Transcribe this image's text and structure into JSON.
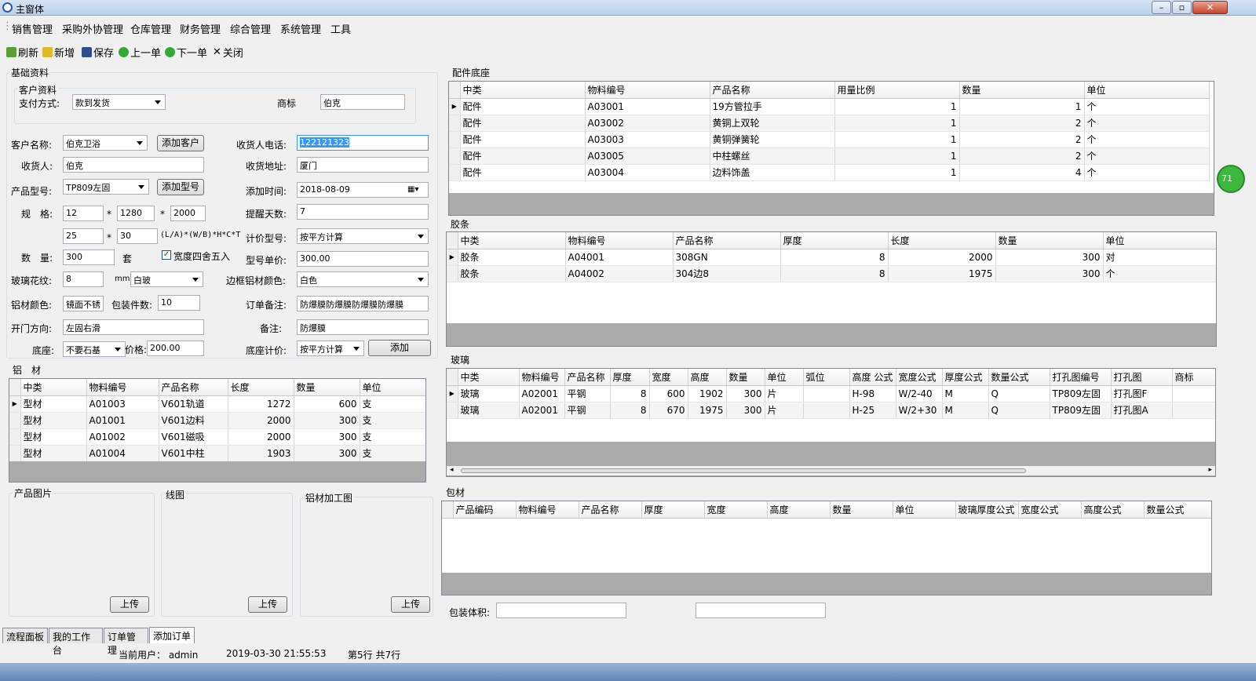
{
  "window": {
    "title": "主窗体"
  },
  "menu": [
    "销售管理",
    "采购外协管理",
    "仓库管理",
    "财务管理",
    "综合管理",
    "系统管理",
    "工具"
  ],
  "toolbar": {
    "refresh": "刷新",
    "new": "新增",
    "save": "保存",
    "prev": "上一单",
    "next": "下一单",
    "close": "关闭"
  },
  "basic": {
    "group_title": "基础资料",
    "customer_group": "客户资料",
    "pay_label": "支付方式:",
    "pay_value": "款到发货",
    "brand_label": "商标",
    "brand_value": "伯克",
    "cust_label": "客户名称:",
    "cust_value": "伯克卫浴",
    "add_cust": "添加客户",
    "phone_label": "收货人电话:",
    "phone_value": "122121323",
    "recv_label": "收货人:",
    "recv_value": "伯克",
    "addr_label": "收货地址:",
    "addr_value": "厦门",
    "model_label": "产品型号:",
    "model_value": "TP809左固",
    "add_model": "添加型号",
    "time_label": "添加时间:",
    "time_value": "2018-08-09",
    "spec_label": "规　格:",
    "spec1": "12",
    "spec2": "1280",
    "spec3": "2000",
    "star": "*",
    "remind_label": "提醒天数:",
    "remind_value": "7",
    "spec4": "25",
    "spec5": "30",
    "formula": "(L/A)*(W/B)*H*C*T",
    "price_type_label": "计价型号:",
    "price_type_value": "按平方计算",
    "qty_label": "数　量:",
    "qty_value": "300",
    "qty_unit": "套",
    "round_label": "宽度四舍五入",
    "unit_price_label": "型号单价:",
    "unit_price_value": "300.00",
    "glass_label": "玻璃花纹:",
    "glass_value": "8",
    "mm": "mm",
    "glass_color": "白玻",
    "frame_label": "边框铝材颜色:",
    "frame_value": "白色",
    "alu_label": "铝材颜色:",
    "alu_value": "镜面不锈",
    "pack_label": "包装件数:",
    "pack_value": "10",
    "remark_order_label": "订单备注:",
    "remark_order_value": "防爆膜防爆膜防爆膜防爆膜",
    "door_label": "开门方向:",
    "door_value": "左固右滑",
    "remark_label": "备注:",
    "remark_value": "防爆膜",
    "base_label": "底座:",
    "base_value": "不要石基",
    "price_label": "价格:",
    "price_value": "200.00",
    "base_price_label": "底座计价:",
    "base_price_value": "按平方计算",
    "add": "添加"
  },
  "alu": {
    "title": "铝　材",
    "cols": [
      "中类",
      "物料编号",
      "产品名称",
      "长度",
      "数量",
      "单位"
    ],
    "rows": [
      [
        "型材",
        "A01003",
        "V601轨道",
        "1272",
        "600",
        "支"
      ],
      [
        "型材",
        "A01001",
        "V601边料",
        "2000",
        "300",
        "支"
      ],
      [
        "型材",
        "A01002",
        "V601磁吸",
        "2000",
        "300",
        "支"
      ],
      [
        "型材",
        "A01004",
        "V601中柱",
        "1903",
        "300",
        "支"
      ]
    ]
  },
  "images": {
    "product": "产品图片",
    "line": "线图",
    "process": "铝材加工图",
    "upload": "上传"
  },
  "parts": {
    "title": "配件底座",
    "cols": [
      "中类",
      "物料编号",
      "产品名称",
      "用量比例",
      "数量",
      "单位"
    ],
    "rows": [
      [
        "配件",
        "A03001",
        "19方管拉手",
        "1",
        "1",
        "个"
      ],
      [
        "配件",
        "A03002",
        "黄铜上双轮",
        "1",
        "2",
        "个"
      ],
      [
        "配件",
        "A03003",
        "黄铜弹簧轮",
        "1",
        "2",
        "个"
      ],
      [
        "配件",
        "A03005",
        "中柱螺丝",
        "1",
        "2",
        "个"
      ],
      [
        "配件",
        "A03004",
        "边料饰盖",
        "1",
        "4",
        "个"
      ]
    ]
  },
  "strip": {
    "title": "胶条",
    "cols": [
      "中类",
      "物料编号",
      "产品名称",
      "厚度",
      "长度",
      "数量",
      "单位"
    ],
    "rows": [
      [
        "胶条",
        "A04001",
        "308GN",
        "8",
        "2000",
        "300",
        "对"
      ],
      [
        "胶条",
        "A04002",
        "304边8",
        "8",
        "1975",
        "300",
        "个"
      ]
    ]
  },
  "glass": {
    "title": "玻璃",
    "cols": [
      "中类",
      "物料编号",
      "产品名称",
      "厚度",
      "宽度",
      "高度",
      "数量",
      "单位",
      "弧位",
      "高度 公式",
      "宽度公式",
      "厚度公式",
      "数量公式",
      "打孔图编号",
      "打孔图",
      "商标"
    ],
    "rows": [
      [
        "玻璃",
        "A02001",
        "平钢",
        "8",
        "600",
        "1902",
        "300",
        "片",
        "",
        "H-98",
        "W/2-40",
        "M",
        "Q",
        "TP809左固",
        "打孔图F",
        ""
      ],
      [
        "玻璃",
        "A02001",
        "平钢",
        "8",
        "670",
        "1975",
        "300",
        "片",
        "",
        "H-25",
        "W/2+30",
        "M",
        "Q",
        "TP809左固",
        "打孔图A",
        ""
      ]
    ]
  },
  "pack": {
    "title": "包材",
    "cols": [
      "产品编码",
      "物料编号",
      "产品名称",
      "厚度",
      "宽度",
      "高度",
      "数量",
      "单位",
      "玻璃厚度公式",
      "宽度公式",
      "高度公式",
      "数量公式"
    ],
    "volume_label": "包装体积:"
  },
  "tabs": [
    "流程面板",
    "我的工作台",
    "订单管理",
    "添加订单"
  ],
  "status": {
    "user": "当前用户： admin",
    "time": "2019-03-30 21:55:53",
    "rows": "第5行  共7行"
  },
  "badge": "71",
  "colors": {
    "accent": "#3399ff",
    "selection": "#3399ff",
    "title_bg": "#c9dcf1"
  }
}
